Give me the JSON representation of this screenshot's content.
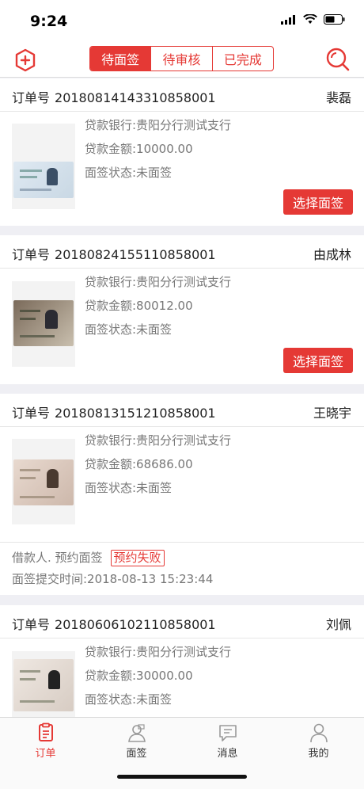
{
  "status_bar": {
    "time": "9:24"
  },
  "nav": {
    "segments": [
      {
        "label": "待面签",
        "active": true
      },
      {
        "label": "待审核",
        "active": false
      },
      {
        "label": "已完成",
        "active": false
      }
    ],
    "accent": "#e53935"
  },
  "orders": [
    {
      "order_label": "订单号",
      "order_no": "2018081414331085800​1",
      "name": "裴磊",
      "bank": "贷款银行:贵阳分行测试支行",
      "amount": "贷款金额:10000.00",
      "status": "面签状态:未面签",
      "button": "选择面签"
    },
    {
      "order_label": "订单号",
      "order_no": "2018082415511085800​1",
      "name": "由成林",
      "bank": "贷款银行:贵阳分行测试支行",
      "amount": "贷款金额:80012.00",
      "status": "面签状态:未面签",
      "button": "选择面签"
    },
    {
      "order_label": "订单号",
      "order_no": "2018081315121085800​1",
      "name": "王晓宇",
      "bank": "贷款银行:贵阳分行测试支行",
      "amount": "贷款金额:68686.00",
      "status": "面签状态:未面签",
      "foot_text": "借款人. 预约面签",
      "foot_badge": "预约失败",
      "foot_time": "面签提交时间:2018-08-13 15:23:44"
    },
    {
      "order_label": "订单号",
      "order_no": "2018060610211085800​1",
      "name": "刘佩",
      "bank": "贷款银行:贵阳分行测试支行",
      "amount": "贷款金额:30000.00",
      "status": "面签状态:未面签"
    }
  ],
  "tabs": [
    {
      "label": "订单",
      "icon": "order-icon",
      "active": true
    },
    {
      "label": "面签",
      "icon": "interview-icon",
      "active": false
    },
    {
      "label": "消息",
      "icon": "message-icon",
      "active": false
    },
    {
      "label": "我的",
      "icon": "profile-icon",
      "active": false
    }
  ]
}
